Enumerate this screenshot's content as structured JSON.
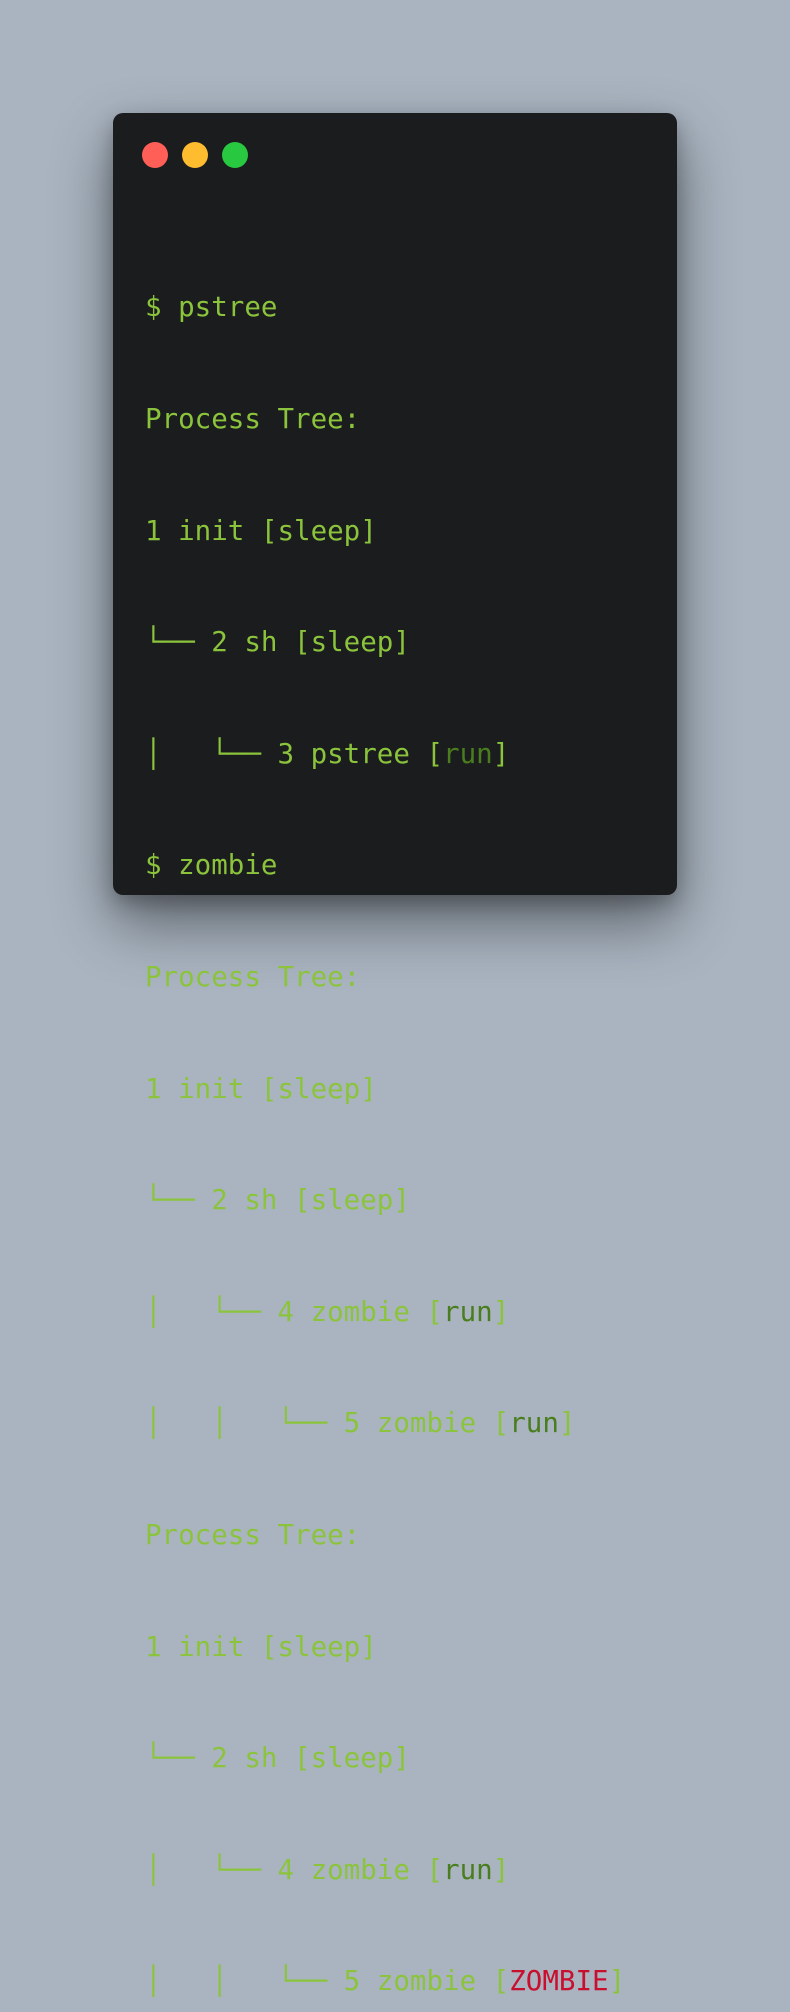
{
  "colors": {
    "background": "#a9b4c0",
    "terminal_bg": "#1b1c1e",
    "text": "#8bc43c",
    "run": "#4a7d1e",
    "zombie": "#c8102e",
    "close": "#ff5f57",
    "minimize": "#febc2e",
    "maximize": "#28c840"
  },
  "icons": {
    "close": "close-dot-icon",
    "minimize": "minimize-dot-icon",
    "maximize": "maximize-dot-icon"
  },
  "terminal": {
    "lines": [
      {
        "text": "$ pstree"
      },
      {
        "text": "Process Tree:"
      },
      {
        "text": "1 init [sleep]"
      },
      {
        "text": "└── 2 sh [sleep]"
      },
      {
        "pre": "│   └── 3 pstree [",
        "status": "run",
        "post": "]"
      },
      {
        "text": "$ zombie"
      },
      {
        "text": "Process Tree:"
      },
      {
        "text": "1 init [sleep]"
      },
      {
        "text": "└── 2 sh [sleep]"
      },
      {
        "pre": "│   └── 4 zombie [",
        "status": "run",
        "post": "]"
      },
      {
        "pre": "│   │   └── 5 zombie [",
        "status": "run",
        "post": "]"
      },
      {
        "text": "Process Tree:"
      },
      {
        "text": "1 init [sleep]"
      },
      {
        "text": "└── 2 sh [sleep]"
      },
      {
        "pre": "│   └── 4 zombie [",
        "status": "run",
        "post": "]"
      },
      {
        "pre": "│   │   └── 5 zombie [",
        "status": "ZOMBIE",
        "post": "]"
      }
    ]
  }
}
